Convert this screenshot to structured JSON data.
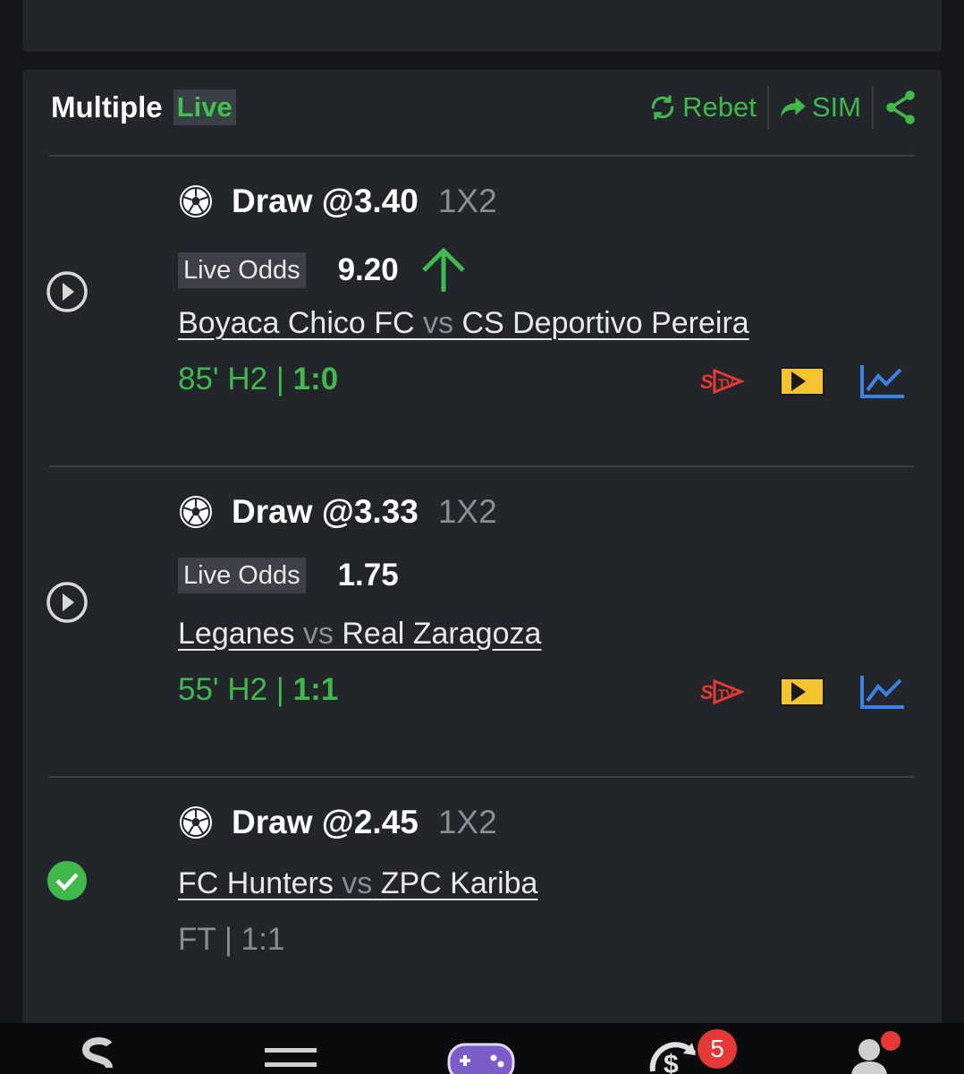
{
  "header": {
    "title": "Multiple",
    "live_badge": "Live",
    "rebet_label": "Rebet",
    "sim_label": "SIM"
  },
  "legs": [
    {
      "status_icon": "play-icon",
      "pick": "Draw @3.40",
      "market": "1X2",
      "live_odds_label": "Live Odds",
      "live_odds_value": "9.20",
      "odds_trend": "up",
      "home": "Boyaca Chico FC",
      "vs": "vs",
      "away": "CS Deportivo Pereira",
      "time": "85' H2 | ",
      "score": "1:0"
    },
    {
      "status_icon": "play-icon",
      "pick": "Draw @3.33",
      "market": "1X2",
      "live_odds_label": "Live Odds",
      "live_odds_value": "1.75",
      "home": "Leganes",
      "vs": "vs",
      "away": "Real Zaragoza",
      "time": "55' H2 | ",
      "score": "1:1"
    },
    {
      "status_icon": "check-circle-icon",
      "pick": "Draw @2.45",
      "market": "1X2",
      "home": "FC Hunters",
      "vs": "vs",
      "away": "ZPC Kariba",
      "time": "FT | 1:1"
    }
  ],
  "bottom_nav": {
    "bets_badge": "5"
  },
  "colors": {
    "accent_green": "#3fb94c",
    "card_bg": "#22252a",
    "badge_red": "#e53935"
  }
}
